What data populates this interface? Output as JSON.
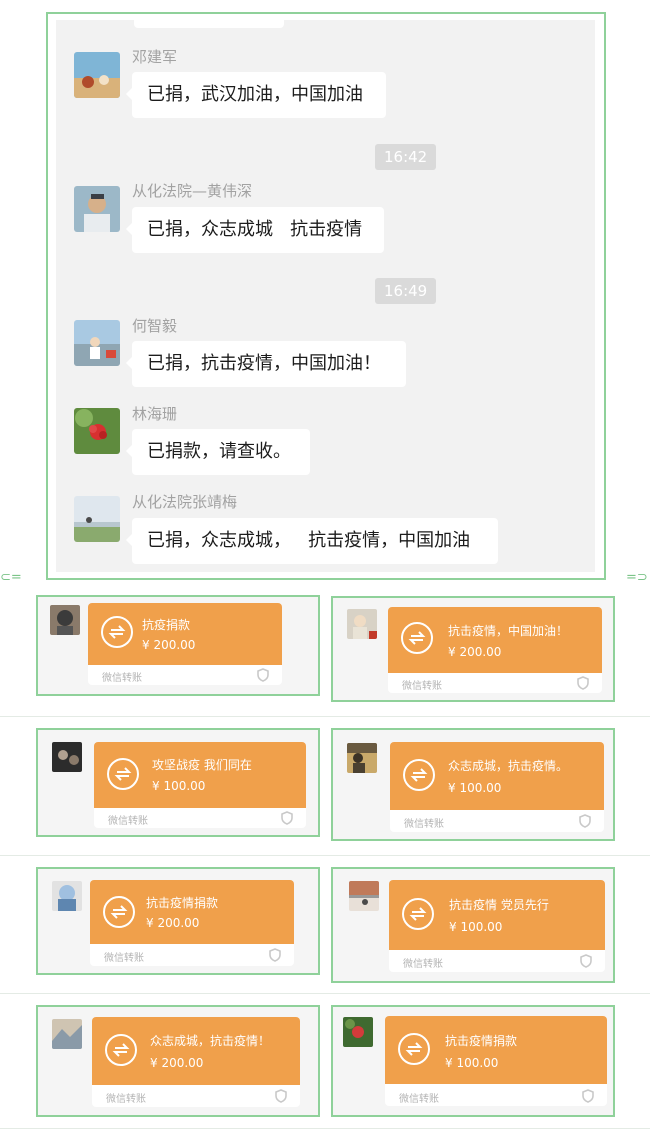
{
  "chat": {
    "messages": [
      {
        "type": "message",
        "sender": "邓建军",
        "text": "已捐，武汉加油，中国加油",
        "avatar_colors": [
          "#7fb5d6",
          "#d9b27a"
        ]
      },
      {
        "type": "time",
        "text": "16:42"
      },
      {
        "type": "message",
        "sender": "从化法院—黄伟深",
        "text": "已捐，众志成城   抗击疫情",
        "avatar_colors": [
          "#9cb8c8",
          "#3a3f46"
        ]
      },
      {
        "type": "time",
        "text": "16:49"
      },
      {
        "type": "message",
        "sender": "何智毅",
        "text": "已捐，抗击疫情，中国加油！",
        "avatar_colors": [
          "#a9c9e2",
          "#d94a3a"
        ]
      },
      {
        "type": "message",
        "sender": "林海珊",
        "text": "已捐款，请查收。",
        "avatar_colors": [
          "#5f8b3e",
          "#d73030"
        ]
      },
      {
        "type": "message",
        "sender": "从化法院张靖梅",
        "text": "已捐，众志成城，   抗击疫情，中国加油",
        "avatar_colors": [
          "#dfe7ee",
          "#8aaa6e"
        ]
      }
    ]
  },
  "transfers": [
    {
      "note": "抗疫捐款",
      "amount": "¥ 200.00",
      "label": "微信转账",
      "avatar_colors": [
        "#3b3b3b",
        "#8a7a6a"
      ]
    },
    {
      "note": "抗击疫情，中国加油！",
      "amount": "¥ 200.00",
      "label": "微信转账",
      "avatar_colors": [
        "#d8d2c6",
        "#c23a2a"
      ]
    },
    {
      "note": "攻坚战疫 我们同在",
      "amount": "¥ 100.00",
      "label": "微信转账",
      "avatar_colors": [
        "#2c2c2c",
        "#b0a090"
      ]
    },
    {
      "note": "众志成城，抗击疫情。",
      "amount": "¥ 100.00",
      "label": "微信转账",
      "avatar_colors": [
        "#6a5a40",
        "#c9a96a"
      ]
    },
    {
      "note": "抗击疫情捐款",
      "amount": "¥ 200.00",
      "label": "微信转账",
      "avatar_colors": [
        "#a0c0e0",
        "#e2e2e2"
      ]
    },
    {
      "note": "抗击疫情 党员先行",
      "amount": "¥ 100.00",
      "label": "微信转账",
      "avatar_colors": [
        "#c07a5a",
        "#e8e0d8"
      ]
    },
    {
      "note": "众志成城，抗击疫情！",
      "amount": "¥ 200.00",
      "label": "微信转账",
      "avatar_colors": [
        "#8a9aa8",
        "#cfc4b2"
      ]
    },
    {
      "note": "抗击疫情捐款",
      "amount": "¥ 100.00",
      "label": "微信转账",
      "avatar_colors": [
        "#3f6a30",
        "#d33b3b"
      ]
    }
  ],
  "icons": {
    "transfer": "transfer-icon",
    "shield": "shield-icon"
  },
  "colors": {
    "frame": "#8fd19a",
    "transfer_orange": "#f0a04b",
    "chat_bg": "#f2f2f2"
  }
}
